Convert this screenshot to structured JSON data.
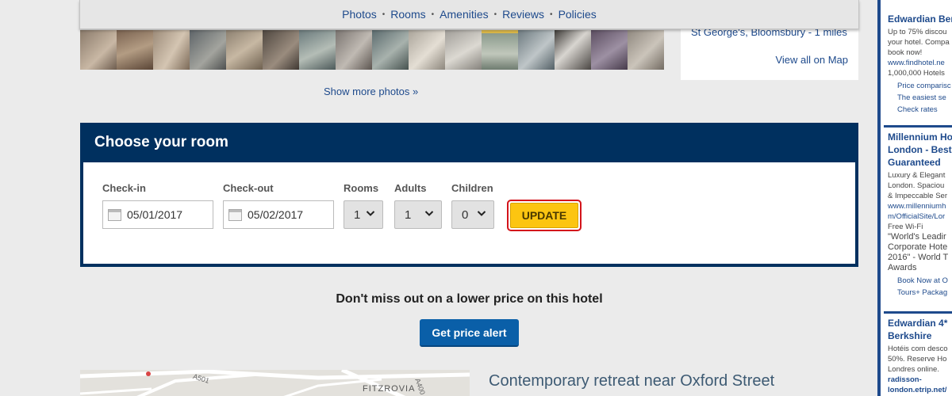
{
  "subnav": {
    "items": [
      "Photos",
      "Rooms",
      "Amenities",
      "Reviews",
      "Policies"
    ],
    "separator": "•"
  },
  "photos": {
    "show_more": "Show more photos »"
  },
  "map_card": {
    "location": "St George's, Bloomsbury - 1 miles",
    "view_all": "View all on Map"
  },
  "room_form": {
    "title": "Choose your room",
    "checkin_label": "Check-in",
    "checkin_value": "05/01/2017",
    "checkout_label": "Check-out",
    "checkout_value": "05/02/2017",
    "rooms_label": "Rooms",
    "rooms_value": "1",
    "adults_label": "Adults",
    "adults_value": "1",
    "children_label": "Children",
    "children_value": "0",
    "update_label": "UPDATE"
  },
  "price_alert": {
    "message": "Don't miss out on a lower price on this hotel",
    "button": "Get price alert"
  },
  "map_section": {
    "heading": "Contemporary retreat near Oxford Street",
    "map_labels": [
      "A501",
      "FITZROVIA",
      "A400"
    ]
  },
  "ads": [
    {
      "title": [
        "Edwardian Ber"
      ],
      "desc": [
        "Up to 75% discou",
        "your hotel. Compa",
        "book now!"
      ],
      "url": [
        "www.findhotel.ne"
      ],
      "extra": [
        "1,000,000 Hotels"
      ],
      "sitelinks": [
        "Price comparisc",
        "The easiest se",
        "Check rates"
      ]
    },
    {
      "title": [
        "Millennium Ho",
        "London - Best",
        "Guaranteed"
      ],
      "desc": [
        "Luxury & Elegant",
        "London. Spaciou",
        "& Impeccable Ser"
      ],
      "url": [
        "www.millenniumh",
        "m/OfficialSite/Lor"
      ],
      "extra": [
        "Free Wi-Fi"
      ],
      "quote": [
        "\"World's Leadir",
        "Corporate Hote",
        "2016\" - World T",
        "Awards"
      ],
      "sitelinks": [
        "Book Now at O",
        "Tours+ Packag"
      ]
    },
    {
      "title": [
        "Edwardian 4*",
        "Berkshire"
      ],
      "desc": [
        "Hotéis com desco",
        "50%. Reserve Ho",
        "Londres online."
      ],
      "url": [
        "radisson-",
        "london.etrip.net/"
      ]
    }
  ],
  "colors": {
    "link": "#1e4a8c",
    "header_navy": "#00305f",
    "update_yellow": "#fcc511",
    "update_outline": "#d3141b",
    "alert_blue": "#0a5fa8"
  }
}
